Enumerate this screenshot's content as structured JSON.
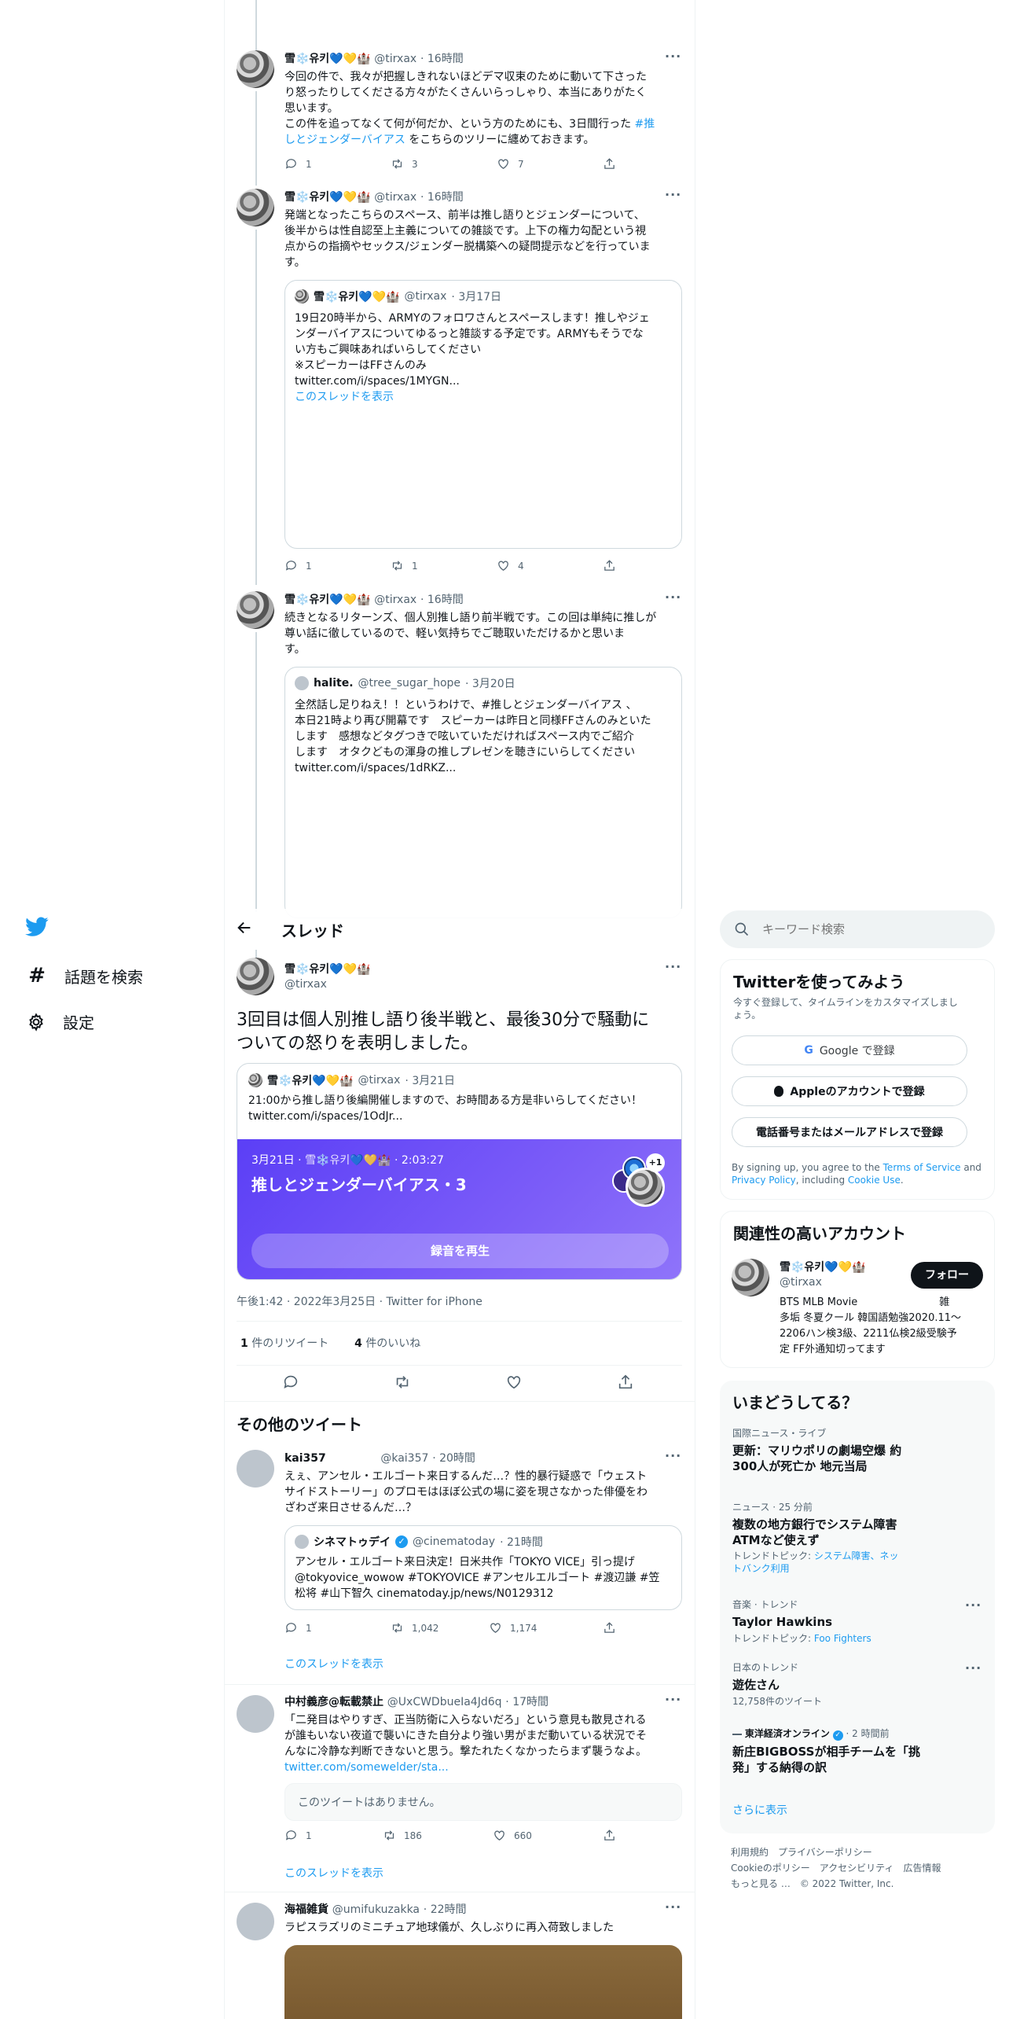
{
  "nav": {
    "explore_label": "話題を検索",
    "settings_label": "設定"
  },
  "header": {
    "title": "スレッド"
  },
  "search": {
    "placeholder": "キーワード検索"
  },
  "author": {
    "display_name": "雪❄️유키💙💛🏰",
    "handle": "@tirxax"
  },
  "thread": [
    {
      "name": "雪❄️유키💙💛🏰",
      "handle": "@tirxax",
      "time": "· 16時間",
      "text_lines": [
        "今回の件で、我々が把握しきれないほどデマ収束のために動いて下さった",
        "り怒ったりしてくださる方々がたくさんいらっしゃり、本当にありがたく",
        "思います。",
        "この件を追ってなくて何が何だか、という方のためにも、3日間行った "
      ],
      "hashtag": "#推",
      "line5_link": "しとジェンダーバイアス",
      "line5_rest": " をこちらのツリーに纏めておきます。",
      "reply": "1",
      "retweet": "3",
      "like": "7"
    },
    {
      "name": "雪❄️유키💙💛🏰",
      "handle": "@tirxax",
      "time": "· 16時間",
      "text_lines": [
        "発端となったこちらのスペース、前半は推し語りとジェンダーについて、",
        "後半からは性自認至上主義についての雑談です。上下の権力勾配という視",
        "点からの指摘やセックス/ジェンダー脱構築への疑問提示などを行っていま",
        "す。"
      ],
      "quote": {
        "name": "雪❄️유키💙💛🏰",
        "handle": "@tirxax",
        "time": "· 3月17日",
        "text_lines": [
          "19日20時半から、ARMYのフォロワさんとスペースします！推しやジェ",
          "ンダーバイアスについてゆるっと雑談する予定です。ARMYもそうでな",
          "い方もご興味あればいらしてください",
          "※スピーカーはFFさんのみ",
          "twitter.com/i/spaces/1MYGN..."
        ],
        "show_thread": "このスレッドを表示"
      },
      "reply": "1",
      "retweet": "1",
      "like": "4"
    },
    {
      "name": "雪❄️유키💙💛🏰",
      "handle": "@tirxax",
      "time": "· 16時間",
      "text_lines": [
        "続きとなるリターンズ、個人別推し語り前半戦です。この回は単純に推しが",
        "尊い話に徹しているので、軽い気持ちでご聴取いただけるかと思いま",
        "す。"
      ],
      "quote": {
        "name": "halite.",
        "handle": "@tree_sugar_hope",
        "time": "· 3月20日",
        "text_lines": [
          "全然話し足りねえ！！というわけで、#推しとジェンダーバイアス 、",
          "本日21時より再び開幕です　スピーカーは昨日と同様FFさんのみといた",
          "します　感想などタグつきで呟いていただければスペース内でご紹介",
          "します　オタクどもの渾身の推しプレゼンを聴きにいらしてください",
          "twitter.com/i/spaces/1dRKZ..."
        ]
      }
    }
  ],
  "main_tweet": {
    "name": "雪❄️유키💙💛🏰",
    "handle": "@tirxax",
    "text_lines": [
      "3回目は個人別推し語り後半戦と、最後30分で騒動に",
      "ついての怒りを表明しました。"
    ],
    "quote": {
      "name": "雪❄️유키💙💛🏰",
      "handle": "@tirxax",
      "time": "· 3月21日",
      "text": "21:00から推し語り後編開催しますので、お時間ある方是非いらしてください！",
      "link": "twitter.com/i/spaces/1OdJr..."
    },
    "space": {
      "date": "3月21日 ·",
      "host": "雪❄️유키💙💛🏰",
      "duration": "· 2:03:27",
      "title": "推しとジェンダーバイアス・3",
      "badge": "+1",
      "play_label": "録音を再生"
    },
    "timestamp": "午後1:42 · 2022年3月25日 · Twitter for iPhone",
    "retweets": "1",
    "retweets_label": "件のリツイート",
    "likes": "4",
    "likes_label": "件のいいね"
  },
  "more_tweets": {
    "title": "その他のツイート",
    "items": [
      {
        "name": "kai357",
        "handle": "@kai357",
        "time": "· 20時間",
        "text_lines": [
          "えぇ、アンセル・エルゴート来日するんだ…？性的暴行疑惑で「ウェスト",
          "サイドストーリー」のプロモはほぼ公式の場に姿を現さなかった俳優をわ",
          "ざわざ来日させるんだ…？"
        ],
        "quote": {
          "name": "シネマトゥデイ",
          "handle": "@cinematoday",
          "time": "· 21時間",
          "text_lines": [
            "アンセル・エルゴート来日決定！日米共作「TOKYO VICE」引っ提げ",
            "@tokyovice_wowow #TOKYOVICE #アンセルエルゴート #渡辺謙 #笠",
            "松将 #山下智久 cinematoday.jp/news/N0129312"
          ]
        },
        "reply": "1",
        "retweet": "1,042",
        "like": "1,174",
        "show_thread": "このスレッドを表示"
      },
      {
        "name": "中村義彦@転載禁止",
        "handle": "@UxCWDbueIa4Jd6q",
        "time": "· 17時間",
        "text_lines": [
          "「二発目はやりすぎ、正当防衛に入らないだろ」という意見も散見される",
          "が誰もいない夜道で襲いにきた自分より強い男がまだ動いている状況でそ",
          "んなに冷静な判断できないと思う。撃たれたくなかったらまず襲うなよ。"
        ],
        "link": "twitter.com/somewelder/sta...",
        "unavailable": "このツイートはありません。",
        "reply": "1",
        "retweet": "186",
        "like": "660",
        "show_thread": "このスレッドを表示"
      },
      {
        "name": "海福雑貨",
        "handle": "@umifukuzakka",
        "time": "· 22時間",
        "text": "ラピスラズリのミニチュア地球儀が、久しぶりに再入荷致しました"
      }
    ]
  },
  "signup": {
    "title": "Twitterを使ってみよう",
    "subtitle_lines": [
      "今すぐ登録して、タイムラインをカスタマイズしまし",
      "ょう。"
    ],
    "google": "Google で登録",
    "apple": "Appleのアカウントで登録",
    "phone": "電話番号またはメールアドレスで登録",
    "legal_1": "By signing up, you agree to the ",
    "terms": "Terms of Service",
    "legal_2": " and",
    "privacy": "Privacy Policy",
    "legal_3": ", including ",
    "cookie": "Cookie Use",
    "legal_4": "."
  },
  "relevant": {
    "title": "関連性の高いアカウント",
    "name": "雪❄️유키💙💛🏰",
    "handle": "@tirxax",
    "follow": "フォロー",
    "bio_lines": [
      "BTS MLB Movie　　　　　　　　雑",
      "多垢 冬夏クール 韓国語勉強2020.11〜",
      "2206ハン検3級、2211仏検2級受験予",
      "定 FF外通知切ってます"
    ]
  },
  "trends": {
    "title": "いまどうしてる？",
    "items": [
      {
        "category": "国際ニュース・ライブ",
        "title_lines": [
          "更新：マリウポリの劇場空爆 約",
          "300人が死亡か 地元当局"
        ]
      },
      {
        "category": "ニュース · 25 分前",
        "title_lines": [
          "複数の地方銀行でシステム障害",
          "ATMなど使えず"
        ],
        "topic_label": "トレンドトピック: ",
        "topic_lines": [
          "システム障害、ネッ",
          "トバンク利用"
        ]
      },
      {
        "category": "音楽 · トレンド",
        "title_lines": [
          "Taylor Hawkins"
        ],
        "topic_label": "トレンドトピック: ",
        "topic_lines": [
          "Foo Fighters"
        ]
      },
      {
        "category": "日本のトレンド",
        "title_lines": [
          "遊佐さん"
        ],
        "count": "12,758件のツイート"
      },
      {
        "source": "東洋経済オンライン",
        "time": "· 2 時間前",
        "title_lines": [
          "新庄BIGBOSSが相手チームを「挑",
          "発」する納得の訳"
        ]
      }
    ],
    "show_more": "さらに表示"
  },
  "footer": {
    "line1": [
      "利用規約",
      "プライバシーポリシー"
    ],
    "line2": [
      "Cookieのポリシー",
      "アクセシビリティ",
      "広告情報"
    ],
    "more": "もっと見る …",
    "copyright": "© 2022 Twitter, Inc."
  }
}
